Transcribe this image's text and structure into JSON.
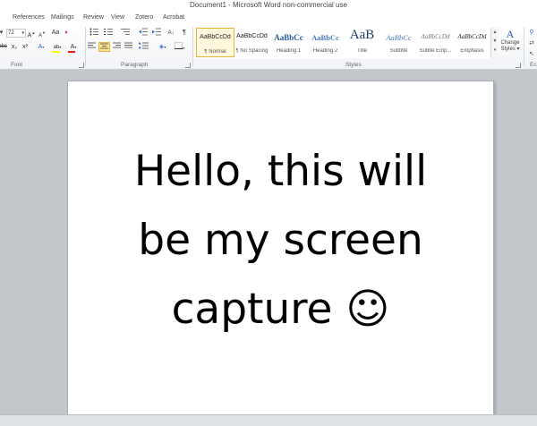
{
  "window": {
    "title": "Document1 - Microsoft Word non-commercial use"
  },
  "tabs": [
    "References",
    "Mailings",
    "Review",
    "View",
    "Zotero",
    "Acrobat"
  ],
  "ribbon": {
    "font": {
      "label": "Font",
      "size": "72",
      "grow": "A",
      "shrink": "A",
      "aa": "Aa",
      "clear": "♦",
      "strike": "abc",
      "sub": "x₂",
      "sup": "x²",
      "effects": "A",
      "highlight": "ab",
      "color": "A",
      "highlight_color": "#ffff00",
      "font_color": "#e02020"
    },
    "paragraph": {
      "label": "Paragraph",
      "pilcrow": "¶"
    },
    "styles": {
      "label": "Styles",
      "items": [
        {
          "sample": "AaBbCcDd",
          "name": "¶ Normal"
        },
        {
          "sample": "AaBbCcDd",
          "name": "¶ No Spacing"
        },
        {
          "sample": "AaBbCc",
          "name": "Heading 1"
        },
        {
          "sample": "AaBbCc",
          "name": "Heading 2"
        },
        {
          "sample": "AaB",
          "name": "Title"
        },
        {
          "sample": "AaBbCc",
          "name": "Subtitle"
        },
        {
          "sample": "AaBbCcDd",
          "name": "Subtle Emp..."
        },
        {
          "sample": "AaBbCcDd",
          "name": "Emphasis"
        }
      ],
      "change_styles_line1": "Change",
      "change_styles_line2": "Styles ▾"
    },
    "editing": {
      "label": "Ec"
    }
  },
  "document": {
    "lines": [
      "Hello, this will",
      "be my screen",
      "capture ☺"
    ]
  }
}
